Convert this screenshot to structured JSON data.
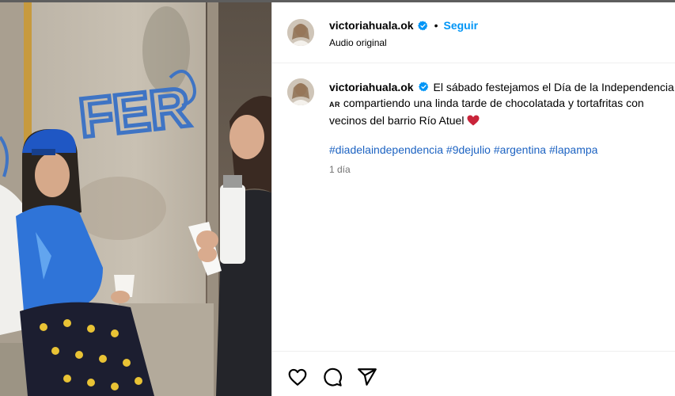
{
  "post": {
    "username": "victoriahuala.ok",
    "verified": true,
    "separator": "•",
    "follow_label": "Seguir",
    "audio_label": "Audio original",
    "caption": {
      "username": "victoriahuala.ok",
      "text_part1": "El sábado festejamos el Día de la Independencia",
      "flag": "AR",
      "text_part2": "compartiendo una linda tarde de chocolatada y tortafritas con vecinos del barrio Río Atuel",
      "emoji": "heart"
    },
    "hashtags": [
      "#diadelaindependencia",
      "#9dejulio",
      "#argentina",
      "#lapampa"
    ],
    "time_ago": "1 día"
  },
  "media": {
    "graffiti_text": "FER"
  },
  "actions": {
    "like_icon": "heart-icon",
    "comment_icon": "comment-icon",
    "share_icon": "paper-plane-icon"
  },
  "colors": {
    "accent": "#0095f6",
    "hashtag": "#1d63c2",
    "muted": "#737373",
    "divider": "#efefef"
  }
}
